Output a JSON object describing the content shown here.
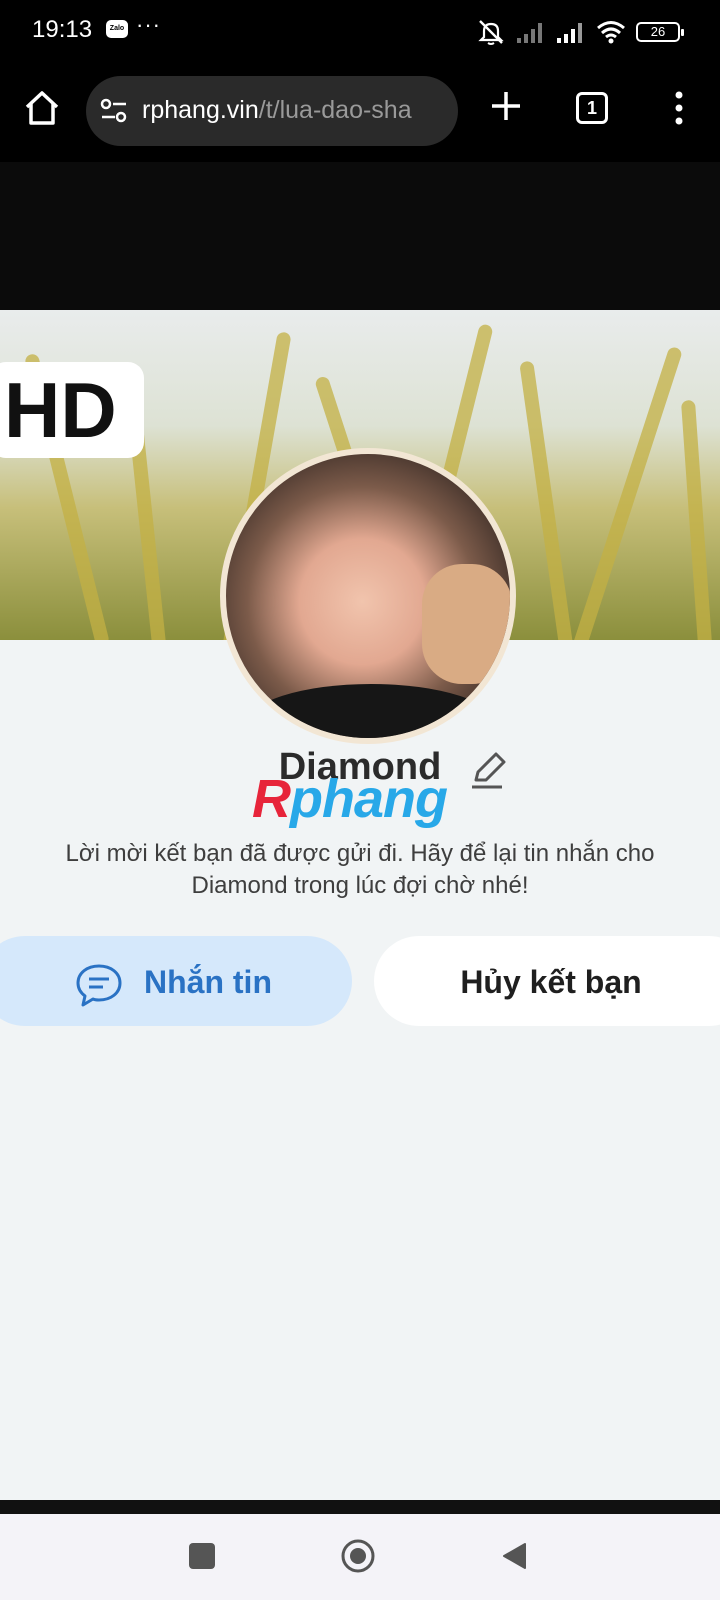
{
  "status_bar": {
    "time": "19:13",
    "app_badge": "Zalo",
    "overflow": "···",
    "battery": "26",
    "icons": [
      "silent-mode-icon",
      "signal-icon",
      "signal-icon",
      "wifi-icon",
      "battery-icon"
    ]
  },
  "browser": {
    "url_domain": "rphang.vin",
    "url_path": "/t/lua-dao-sha",
    "tab_count": "1",
    "icons": [
      "home-icon",
      "site-settings-icon",
      "new-tab-icon",
      "tab-switcher-icon",
      "more-menu-icon"
    ]
  },
  "profile": {
    "cover_badge": "HD",
    "name": "Diamond",
    "watermark_first": "R",
    "watermark_rest": "phang",
    "info_line1": "Lời mời kết bạn đã được gửi đi. Hãy để lại tin nhắn cho",
    "info_line2": "Diamond trong lúc đợi chờ nhé!",
    "message_button": "Nhắn tin",
    "cancel_button": "Hủy kết bạn"
  },
  "colors": {
    "message_button_bg": "#d5e8fb",
    "message_button_text": "#2a72c4",
    "watermark_red": "#e7243a",
    "watermark_blue": "#28a8e8"
  }
}
